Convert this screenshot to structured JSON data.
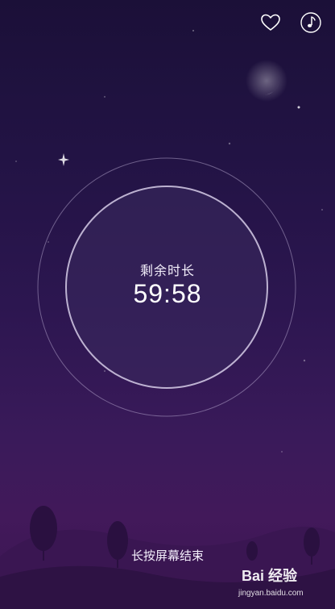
{
  "timer": {
    "label": "剩余时长",
    "value": "59:58"
  },
  "footer": {
    "end_hint": "长按屏幕结束"
  },
  "watermark": {
    "logo": "Bai 经验",
    "brand": "",
    "url": "jingyan.baidu.com"
  },
  "icons": {
    "favorite": "heart-icon",
    "music": "music-note-icon",
    "moon": "crescent-moon-icon"
  },
  "colors": {
    "sky_top": "#1b1038",
    "sky_bottom": "#42195a",
    "ring": "#c9bde0",
    "text": "#ffffff"
  }
}
